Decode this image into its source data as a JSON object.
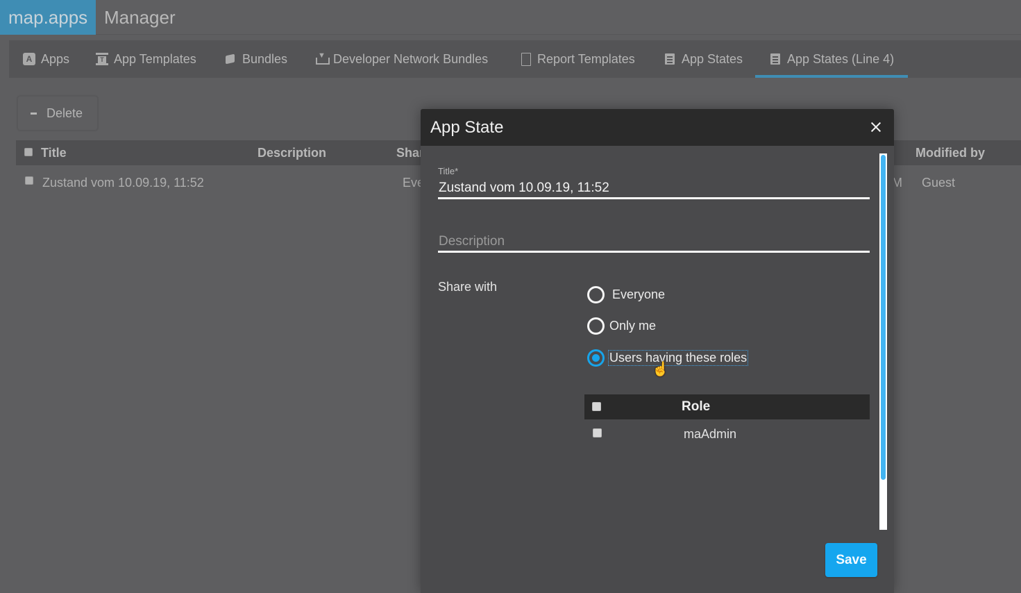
{
  "header": {
    "brand": "map.apps",
    "subtitle": "Manager"
  },
  "tabs": [
    {
      "label": "Apps",
      "icon": "app-icon"
    },
    {
      "label": "App Templates",
      "icon": "template-icon"
    },
    {
      "label": "Bundles",
      "icon": "box-icon"
    },
    {
      "label": "Developer Network Bundles",
      "icon": "download-icon"
    },
    {
      "label": "Report Templates",
      "icon": "document-icon"
    },
    {
      "label": "App States",
      "icon": "list-icon"
    },
    {
      "label": "App States (Line 4)",
      "icon": "list-icon",
      "active": true
    }
  ],
  "toolbar": {
    "delete_label": "Delete"
  },
  "grid": {
    "columns": [
      "Title",
      "Description",
      "Shar",
      "Modified by"
    ],
    "rows": [
      {
        "title": "Zustand vom 10.09.19, 11:52",
        "description": "",
        "share": "Eve",
        "modified_partial": "M",
        "modified_by": "Guest"
      }
    ]
  },
  "dialog": {
    "title": "App State",
    "title_field_label": "Title*",
    "title_value": "Zustand vom 10.09.19, 11:52",
    "description_placeholder": "Description",
    "description_value": "",
    "share_label": "Share with",
    "share_options": [
      {
        "label": "Everyone",
        "checked": false
      },
      {
        "label": "Only me",
        "checked": false
      },
      {
        "label": "Users having these roles",
        "checked": true
      }
    ],
    "roles_table": {
      "header": "Role",
      "rows": [
        "maAdmin"
      ]
    },
    "save_label": "Save",
    "accent_color": "#15a6ef"
  }
}
